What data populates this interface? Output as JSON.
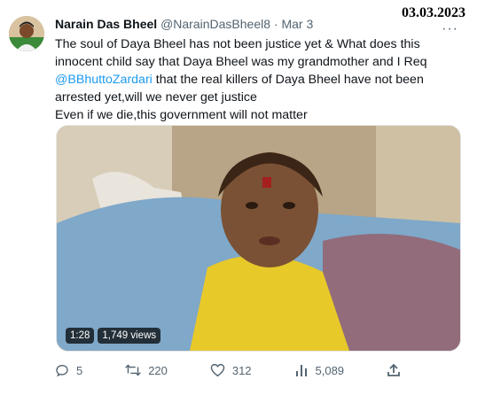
{
  "stamp_date": "03.03.2023",
  "tweet": {
    "author_name": "Narain Das Bheel",
    "handle": "@NarainDasBheel8",
    "separator": "·",
    "date": "Mar 3",
    "more_label": "···",
    "lines": [
      "The soul of Daya Bheel has not been justice yet & What does this",
      "innocent child say that Daya Bheel was my grandmother and I Req",
      "",
      "arrested yet,will we never get justice",
      "Even if we die,this government will not matter"
    ],
    "mention": "@BBhuttoZardari",
    "line3_rest": " that the real killers of Daya Bheel have not been"
  },
  "video": {
    "duration": "1:28",
    "views": "1,749 views"
  },
  "actions": {
    "replies": "5",
    "retweets": "220",
    "likes": "312",
    "views": "5,089"
  },
  "icons": {
    "reply": "reply-icon",
    "retweet": "retweet-icon",
    "like": "heart-icon",
    "views": "views-icon",
    "share": "share-icon"
  },
  "colors": {
    "link": "#1d9bf0",
    "muted": "#536471",
    "text": "#0f1419"
  }
}
